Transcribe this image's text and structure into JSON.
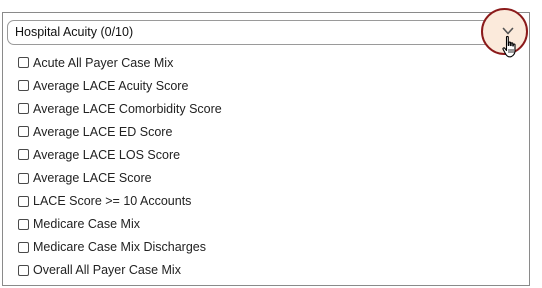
{
  "dropdown": {
    "selected_label": "Hospital Acuity (0/10)",
    "toggle_icon": "chevron-down-icon",
    "cursor_icon": "hand-pointer-icon",
    "highlight_color": "#8b1a1a",
    "highlight_fill": "#fbeadb"
  },
  "options": [
    {
      "label": "Acute All Payer Case Mix",
      "checked": false
    },
    {
      "label": "Average LACE Acuity Score",
      "checked": false
    },
    {
      "label": "Average LACE Comorbidity Score",
      "checked": false
    },
    {
      "label": "Average LACE ED Score",
      "checked": false
    },
    {
      "label": "Average LACE LOS Score",
      "checked": false
    },
    {
      "label": "Average LACE Score",
      "checked": false
    },
    {
      "label": "LACE Score >= 10 Accounts",
      "checked": false
    },
    {
      "label": "Medicare Case Mix",
      "checked": false
    },
    {
      "label": "Medicare Case Mix Discharges",
      "checked": false
    },
    {
      "label": "Overall All Payer Case Mix",
      "checked": false
    }
  ]
}
